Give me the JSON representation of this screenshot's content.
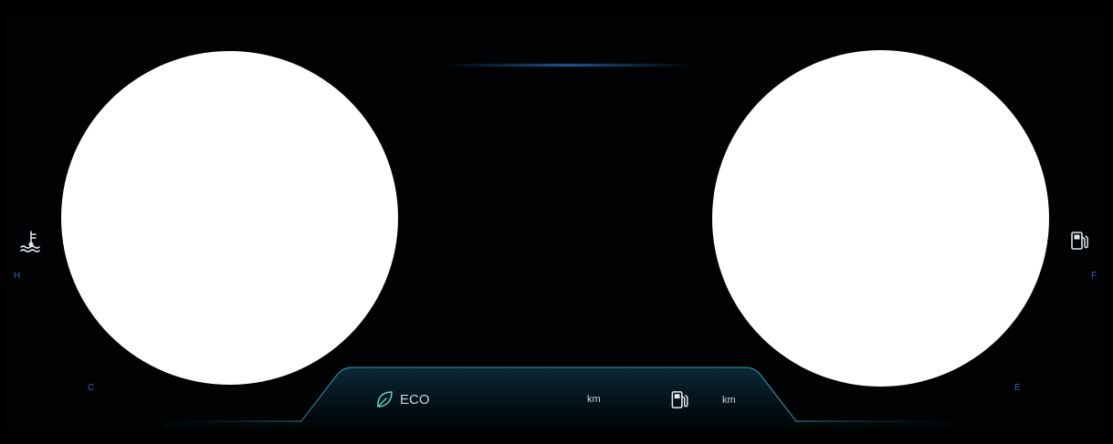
{
  "gauges": {
    "temperature": {
      "icon": "coolant-temperature-icon",
      "high_label": "H",
      "low_label": "C"
    },
    "fuel": {
      "icon": "fuel-pump-icon",
      "full_label": "F",
      "empty_label": "E"
    }
  },
  "info_bar": {
    "drive_mode_icon": "leaf-icon",
    "drive_mode_label": "ECO",
    "range_unit": "km",
    "fuel_icon": "fuel-pump-icon",
    "trip_unit": "km"
  },
  "colors": {
    "background": "#000000",
    "accent_glow": "#2a6fb4",
    "panel_border": "#2e8fa0",
    "label_blue": "#3f62a8",
    "leaf_green": "#5fd7b6",
    "text": "#c9d6e4"
  }
}
